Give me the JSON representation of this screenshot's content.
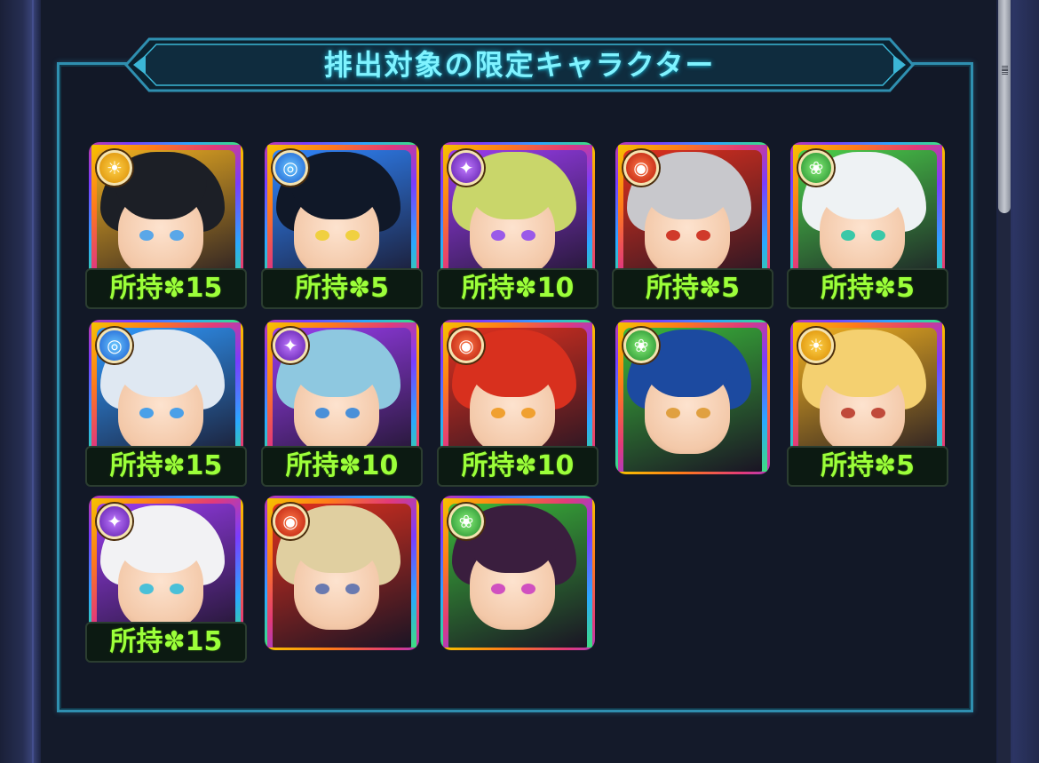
{
  "panel": {
    "title": "排出対象の限定キャラクター"
  },
  "colors": {
    "accent": "#7ff3ff",
    "owned_text": "#9cff3a",
    "panel_border": "#2f8fb0"
  },
  "owned_prefix": "所持",
  "clover_glyph": "✽",
  "characters": [
    {
      "element": "light",
      "element_icon": "sun-icon",
      "owned_count": "15",
      "owned_label": "所持✽15",
      "hair": "#1c1f26",
      "eye": "#5aa7e8",
      "bg": "#f0b020"
    },
    {
      "element": "water",
      "element_icon": "water-drop-icon",
      "owned_count": "5",
      "owned_label": "所持✽5",
      "hair": "#101828",
      "eye": "#f0d040",
      "bg": "#2f86ff"
    },
    {
      "element": "dark",
      "element_icon": "dark-orb-icon",
      "owned_count": "10",
      "owned_label": "所持✽10",
      "hair": "#c9d66a",
      "eye": "#9a5ae8",
      "bg": "#9a3cf0"
    },
    {
      "element": "fire",
      "element_icon": "flame-icon",
      "owned_count": "5",
      "owned_label": "所持✽5",
      "hair": "#c8c8cc",
      "eye": "#d03a2a",
      "bg": "#e0301e"
    },
    {
      "element": "wood",
      "element_icon": "leaf-icon",
      "owned_count": "5",
      "owned_label": "所持✽5",
      "hair": "#eef2f4",
      "eye": "#3ac8a8",
      "bg": "#4ad04a"
    },
    {
      "element": "water",
      "element_icon": "water-drop-icon",
      "owned_count": "15",
      "owned_label": "所持✽15",
      "hair": "#dfe8f2",
      "eye": "#4aa0e8",
      "bg": "#2f9aff"
    },
    {
      "element": "dark",
      "element_icon": "dark-orb-icon",
      "owned_count": "10",
      "owned_label": "所持✽10",
      "hair": "#8ec8e0",
      "eye": "#4a90d8",
      "bg": "#9a3cf0"
    },
    {
      "element": "fire",
      "element_icon": "flame-icon",
      "owned_count": "10",
      "owned_label": "所持✽10",
      "hair": "#d8301e",
      "eye": "#f0a030",
      "bg": "#e0301e"
    },
    {
      "element": "wood",
      "element_icon": "leaf-icon",
      "owned_count": "",
      "owned_label": "",
      "hair": "#1c4aa0",
      "eye": "#e0a040",
      "bg": "#3ab83a"
    },
    {
      "element": "light",
      "element_icon": "sun-icon",
      "owned_count": "5",
      "owned_label": "所持✽5",
      "hair": "#f4d070",
      "eye": "#c04a3a",
      "bg": "#f0b020"
    },
    {
      "element": "dark",
      "element_icon": "dark-orb-icon",
      "owned_count": "15",
      "owned_label": "所持✽15",
      "hair": "#f2f2f4",
      "eye": "#4ac0d8",
      "bg": "#9a3cf0"
    },
    {
      "element": "fire",
      "element_icon": "flame-icon",
      "owned_count": "",
      "owned_label": "",
      "hair": "#e0cfa0",
      "eye": "#6a7ab0",
      "bg": "#e0301e"
    },
    {
      "element": "wood",
      "element_icon": "leaf-icon",
      "owned_count": "",
      "owned_label": "",
      "hair": "#3a1e3e",
      "eye": "#d050c0",
      "bg": "#3ab83a"
    }
  ]
}
